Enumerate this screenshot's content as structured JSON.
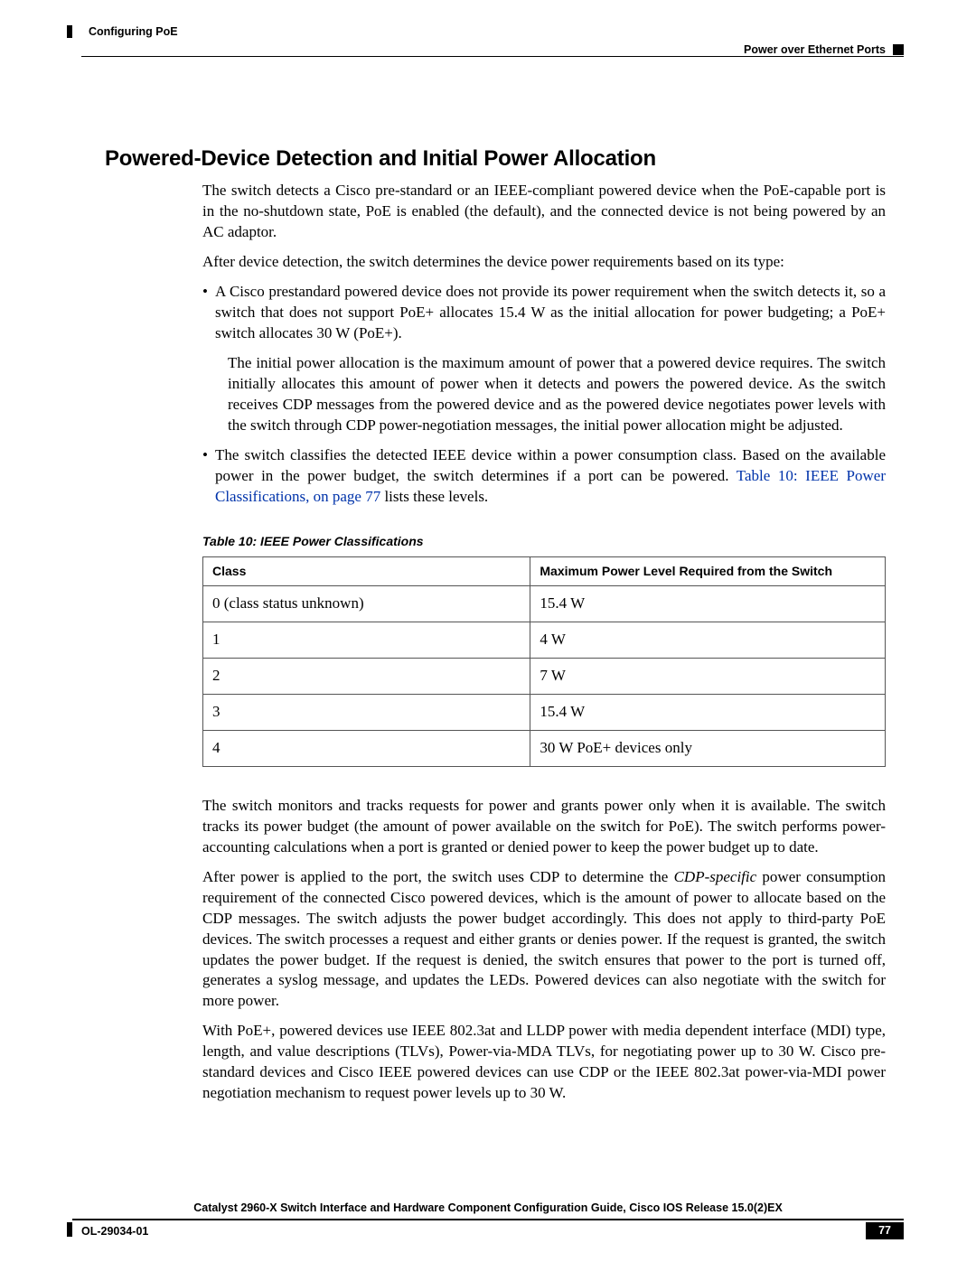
{
  "header": {
    "left": "Configuring PoE",
    "right": "Power over Ethernet Ports"
  },
  "section": {
    "title": "Powered-Device Detection and Initial Power Allocation",
    "p1": "The switch detects a Cisco pre-standard or an IEEE-compliant powered device when the PoE-capable port is in the no-shutdown state, PoE is enabled (the default), and the connected device is not being powered by an AC adaptor.",
    "p2": "After device detection, the switch determines the device power requirements based on its type:",
    "bullets": [
      {
        "text": "A Cisco prestandard powered device does not provide its power requirement when the switch detects it, so a switch that does not support PoE+ allocates 15.4 W as the initial allocation for power budgeting; a PoE+ switch allocates 30 W (PoE+).",
        "sub": "The initial power allocation is the maximum amount of power that a powered device requires. The switch initially allocates this amount of power when it detects and powers the powered device. As the switch receives CDP messages from the powered device and as the powered device negotiates power levels with the switch through CDP power-negotiation messages, the initial power allocation might be adjusted."
      },
      {
        "text_pre": "The switch classifies the detected IEEE device within a power consumption class. Based on the available power in the power budget, the switch determines if a port can be powered. ",
        "link": "Table 10: IEEE Power Classifications,  on page 77",
        "text_post": " lists these levels."
      }
    ],
    "table_title": "Table 10: IEEE Power Classifications",
    "table": {
      "headers": [
        "Class",
        "Maximum Power Level Required from the Switch"
      ],
      "rows": [
        [
          "0 (class status unknown)",
          "15.4 W"
        ],
        [
          "1",
          "4 W"
        ],
        [
          "2",
          "7 W"
        ],
        [
          "3",
          "15.4 W"
        ],
        [
          "4",
          "30 W PoE+ devices only"
        ]
      ]
    },
    "p3": "The switch monitors and tracks requests for power and grants power only when it is available. The switch tracks its power budget (the amount of power available on the switch for PoE). The switch performs power-accounting calculations when a port is granted or denied power to keep the power budget up to date.",
    "p4_pre": "After power is applied to the port, the switch uses CDP to determine the ",
    "p4_italic": "CDP-specific",
    "p4_post": " power consumption requirement of the connected Cisco powered devices, which is the amount of power to allocate based on the CDP messages. The switch adjusts the power budget accordingly. This does not apply to third-party PoE devices. The switch processes a request and either grants or denies power. If the request is granted, the switch updates the power budget. If the request is denied, the switch ensures that power to the port is turned off, generates a syslog message, and updates the LEDs. Powered devices can also negotiate with the switch for more power.",
    "p5": "With PoE+, powered devices use IEEE 802.3at and LLDP power with media dependent interface (MDI) type, length, and value descriptions (TLVs), Power-via-MDA TLVs, for negotiating power up to 30 W. Cisco pre-standard devices and Cisco IEEE powered devices can use CDP or the IEEE 802.3at power-via-MDI power negotiation mechanism to request power levels up to 30 W."
  },
  "footer": {
    "title": "Catalyst 2960-X Switch Interface and Hardware Component Configuration Guide, Cisco IOS Release 15.0(2)EX",
    "left": "OL-29034-01",
    "page": "77"
  }
}
